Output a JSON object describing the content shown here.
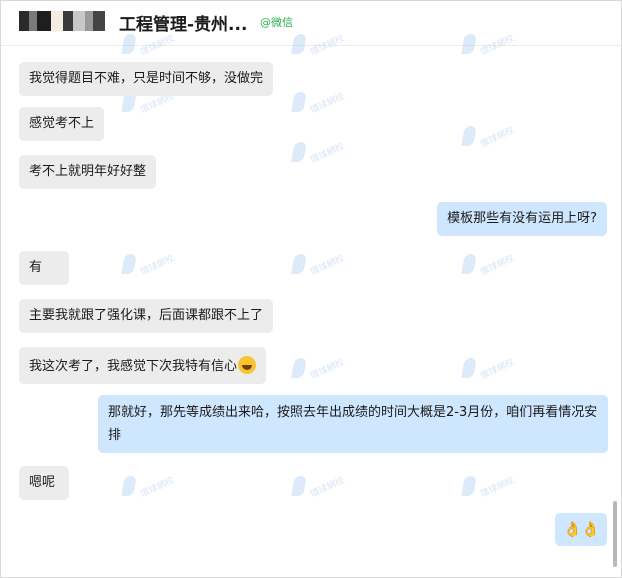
{
  "header": {
    "title": "工程管理-贵州...",
    "source_tag": "@微信"
  },
  "messages": [
    {
      "side": "left",
      "text": "我觉得题目不难，只是时间不够，没做完"
    },
    {
      "side": "left",
      "text": "感觉考不上"
    },
    {
      "side": "left",
      "text": "考不上就明年好好整"
    },
    {
      "side": "right",
      "text": "模板那些有没有运用上呀?"
    },
    {
      "side": "left",
      "text": "有"
    },
    {
      "side": "left",
      "text": "主要我就跟了强化课，后面课都跟不上了"
    },
    {
      "side": "left",
      "text": "我这次考了，我感觉下次我特有信心",
      "emoji": "grinning-sweat-emoji"
    },
    {
      "side": "right",
      "text": "那就好，那先等成绩出来哈，按照去年出成绩的时间大概是2-3月份，咱们再看情况安排"
    },
    {
      "side": "left",
      "text": "嗯呢"
    },
    {
      "side": "right",
      "text": "",
      "emoji": "ok-hand-emoji ok-hand-emoji"
    }
  ],
  "colors": {
    "incoming_bubble": "#ececec",
    "outgoing_bubble": "#cfe6ff",
    "source_tag": "#2bae4a"
  }
}
